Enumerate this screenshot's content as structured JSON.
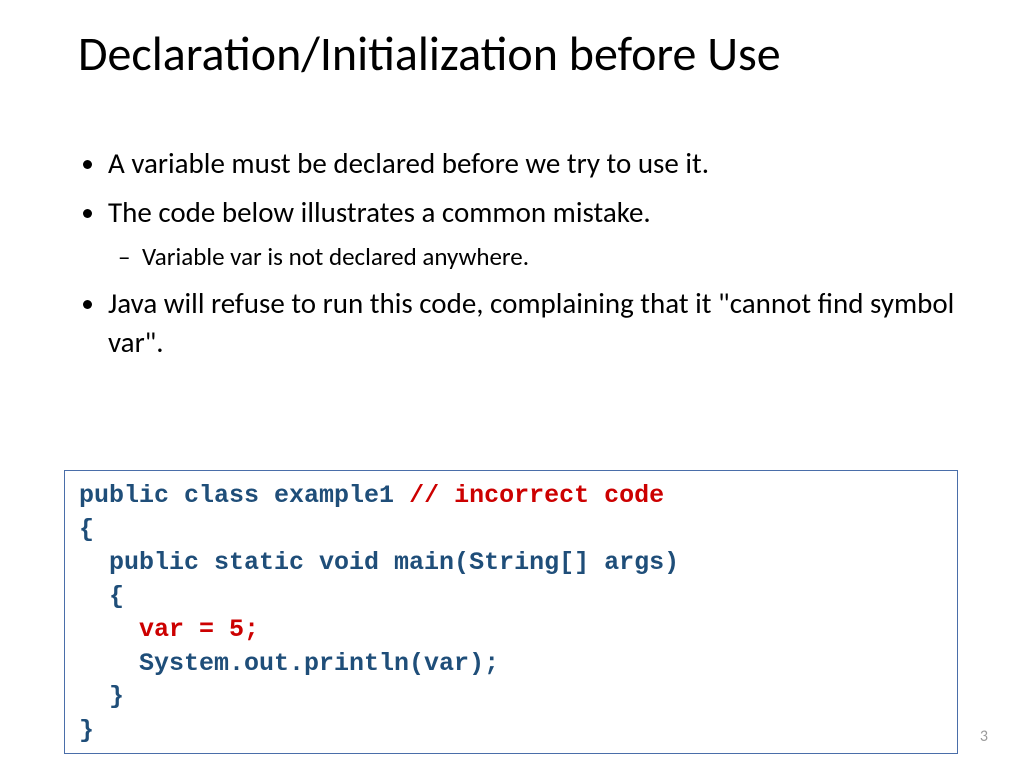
{
  "title": "Declaration/Initialization before Use",
  "bullets": {
    "b1": "A variable must be declared before we try to use it.",
    "b2": "The code below illustrates a common mistake.",
    "b2a": "Variable var is not declared anywhere.",
    "b3": "Java will refuse to run this code, complaining that it \"cannot find symbol var\"."
  },
  "code": {
    "l1a": "public class example1 ",
    "l1b": "// incorrect code",
    "l2": "{",
    "l3": "  public static void main(String[] args)",
    "l4": "  {",
    "l5": "    var = 5;",
    "l6": "    System.out.println(var);",
    "l7": "  }",
    "l8": "}"
  },
  "page_number": "3"
}
